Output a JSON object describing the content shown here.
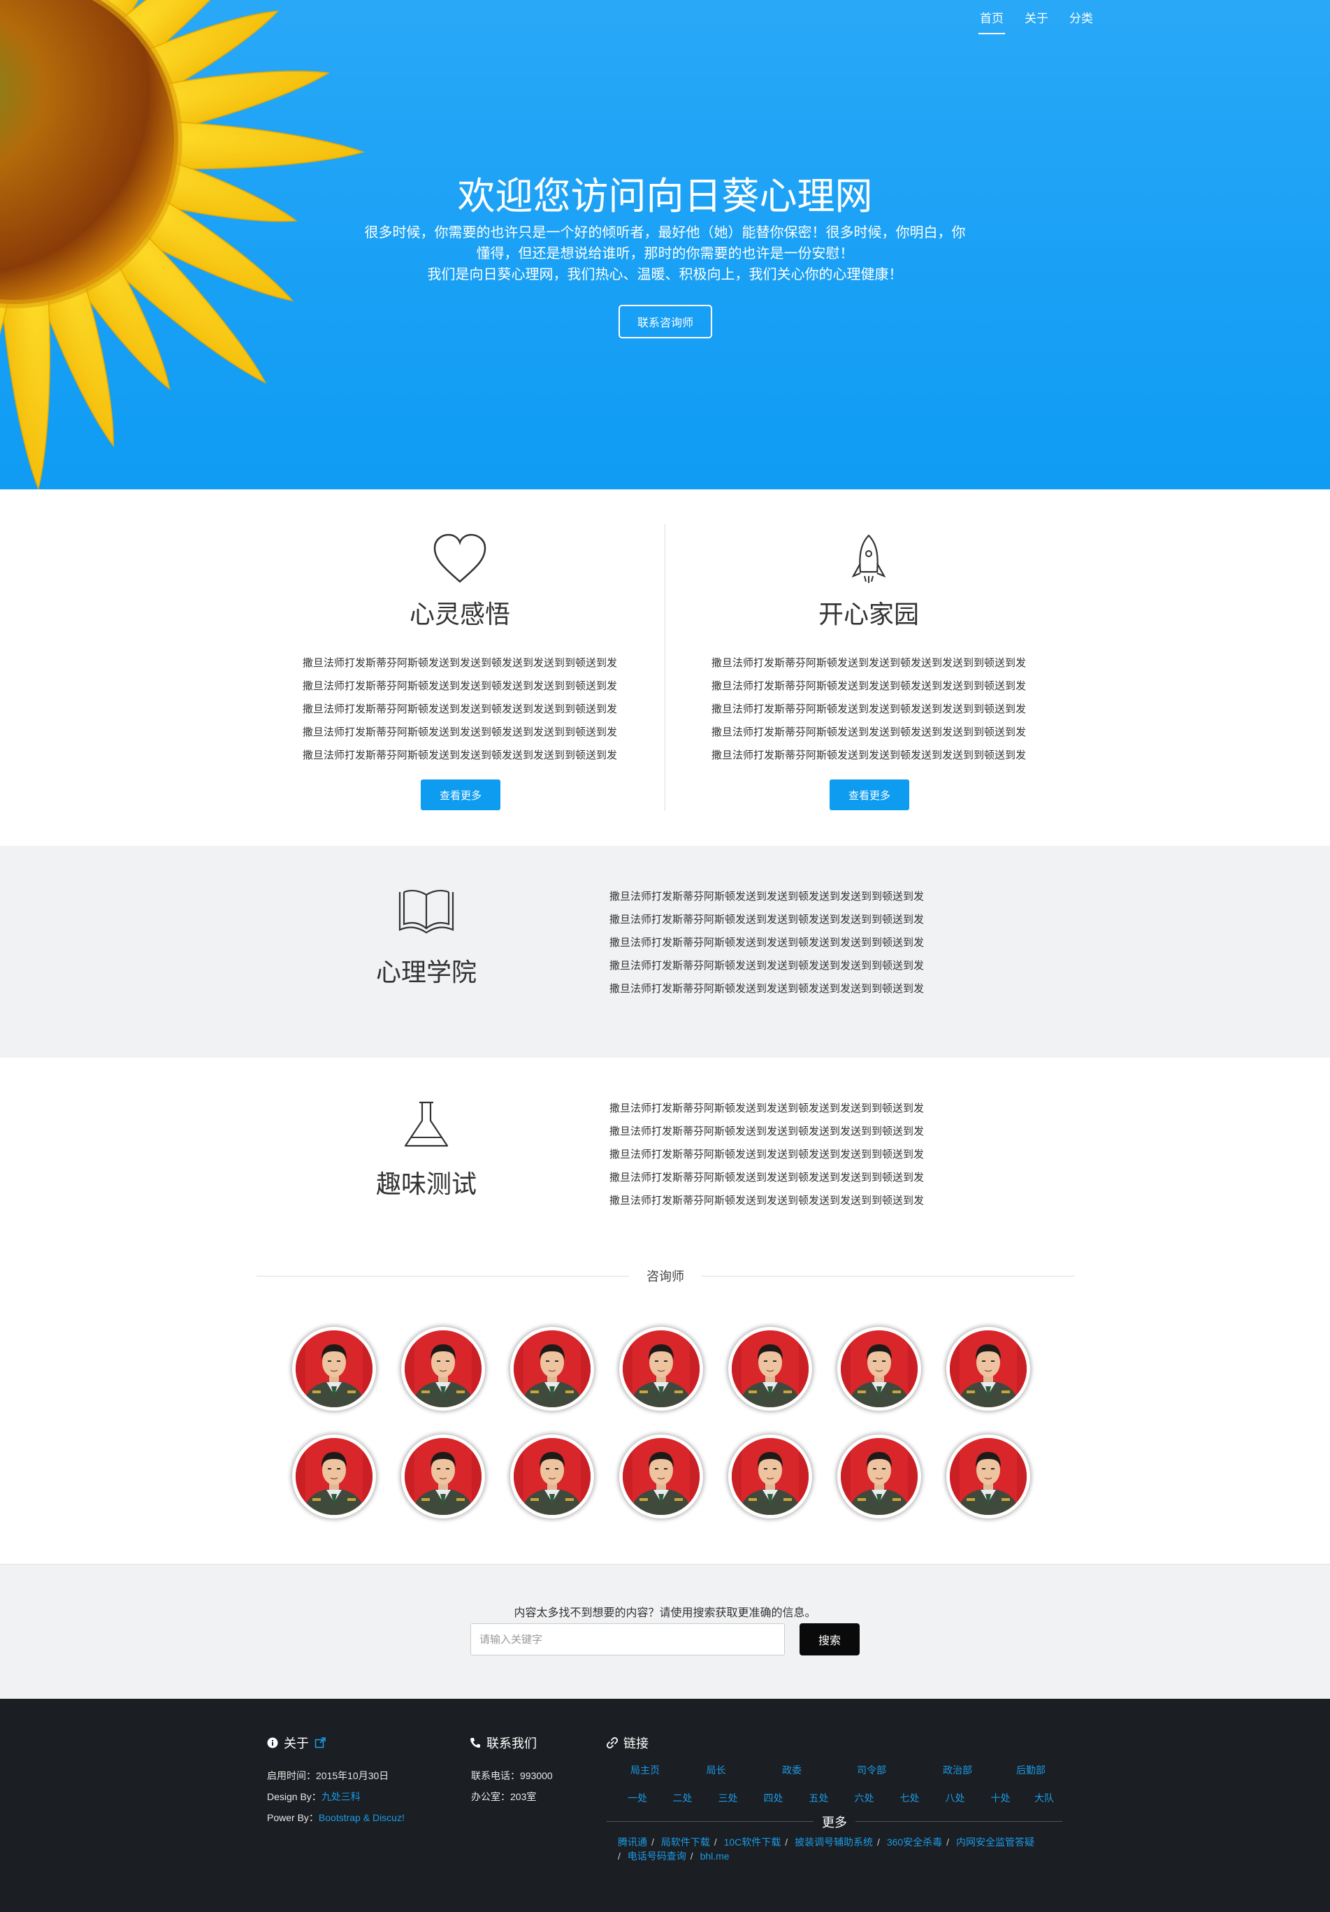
{
  "nav": {
    "items": [
      "首页",
      "关于",
      "分类"
    ]
  },
  "hero": {
    "title": "欢迎您访问向日葵心理网",
    "line1": "很多时候，你需要的也许只是一个好的倾听者，最好他（她）能替你保密！很多时候，你明白，你",
    "line2": "懂得，但还是想说给谁听，那时的你需要的也许是一份安慰！",
    "line3": "我们是向日葵心理网，我们热心、温暖、积极向上，我们关心你的心理健康！",
    "button": "联系咨询师"
  },
  "features": [
    {
      "icon": "heart-icon",
      "title": "心灵感悟",
      "lines": [
        "撒旦法师打发斯蒂芬阿斯顿发送到发送到顿发送到发送到到顿送到发",
        "撒旦法师打发斯蒂芬阿斯顿发送到发送到顿发送到发送到到顿送到发",
        "撒旦法师打发斯蒂芬阿斯顿发送到发送到顿发送到发送到到顿送到发",
        "撒旦法师打发斯蒂芬阿斯顿发送到发送到顿发送到发送到到顿送到发",
        "撒旦法师打发斯蒂芬阿斯顿发送到发送到顿发送到发送到到顿送到发"
      ],
      "button": "查看更多"
    },
    {
      "icon": "rocket-icon",
      "title": "开心家园",
      "lines": [
        "撒旦法师打发斯蒂芬阿斯顿发送到发送到顿发送到发送到到顿送到发",
        "撒旦法师打发斯蒂芬阿斯顿发送到发送到顿发送到发送到到顿送到发",
        "撒旦法师打发斯蒂芬阿斯顿发送到发送到顿发送到发送到到顿送到发",
        "撒旦法师打发斯蒂芬阿斯顿发送到发送到顿发送到发送到到顿送到发",
        "撒旦法师打发斯蒂芬阿斯顿发送到发送到顿发送到发送到到顿送到发"
      ],
      "button": "查看更多"
    }
  ],
  "academy": {
    "icon": "book-icon",
    "title": "心理学院",
    "lines": [
      "撒旦法师打发斯蒂芬阿斯顿发送到发送到顿发送到发送到到顿送到发",
      "撒旦法师打发斯蒂芬阿斯顿发送到发送到顿发送到发送到到顿送到发",
      "撒旦法师打发斯蒂芬阿斯顿发送到发送到顿发送到发送到到顿送到发",
      "撒旦法师打发斯蒂芬阿斯顿发送到发送到顿发送到发送到到顿送到发",
      "撒旦法师打发斯蒂芬阿斯顿发送到发送到顿发送到发送到到顿送到发"
    ]
  },
  "quiz": {
    "icon": "flask-icon",
    "title": "趣味测试",
    "lines": [
      "撒旦法师打发斯蒂芬阿斯顿发送到发送到顿发送到发送到到顿送到发",
      "撒旦法师打发斯蒂芬阿斯顿发送到发送到顿发送到发送到到顿送到发",
      "撒旦法师打发斯蒂芬阿斯顿发送到发送到顿发送到发送到到顿送到发",
      "撒旦法师打发斯蒂芬阿斯顿发送到发送到顿发送到发送到到顿送到发",
      "撒旦法师打发斯蒂芬阿斯顿发送到发送到顿发送到发送到到顿送到发"
    ]
  },
  "counselors": {
    "label": "咨询师",
    "count": 14
  },
  "search": {
    "hint": "内容太多找不到想要的内容？请使用搜索获取更准确的信息。",
    "placeholder": "请输入关键字",
    "button": "搜索"
  },
  "footer": {
    "about": {
      "heading": "关于",
      "launch_label": "启用时间：",
      "launch_value": "2015年10月30日",
      "design_label": "Design By：",
      "design_value": "九处三科",
      "power_label": "Power By：",
      "power_value": "Bootstrap & Discuz!"
    },
    "contact": {
      "heading": "联系我们",
      "phone_label": "联系电话：",
      "phone_value": "993000",
      "office_label": "办公室：",
      "office_value": "203室"
    },
    "links": {
      "heading": "链接",
      "row1": [
        "局主页",
        "局长",
        "政委",
        "司令部",
        "政治部",
        "后勤部"
      ],
      "row2": [
        "一处",
        "二处",
        "三处",
        "四处",
        "五处",
        "六处",
        "七处",
        "八处",
        "十处",
        "大队"
      ],
      "more": "更多",
      "external": [
        "腾讯通",
        "局软件下载",
        "10C软件下载",
        "披装调号辅助系统",
        "360安全杀毒",
        "内网安全监管答疑",
        "电话号码查询",
        "bhl.me"
      ]
    }
  },
  "colors": {
    "hero_blue": "#18a0f5",
    "button_blue": "#0e9cf0",
    "footer_bg": "#1b1e22",
    "link_blue": "#1a9be8"
  }
}
